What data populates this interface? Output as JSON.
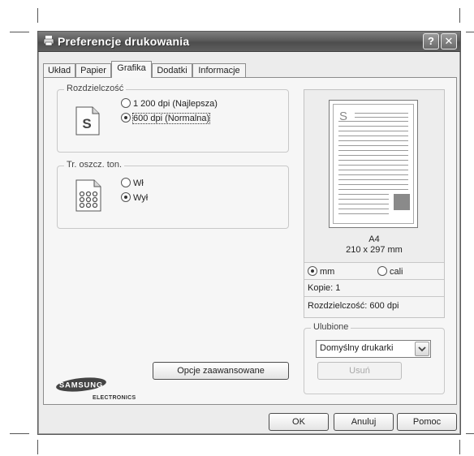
{
  "window": {
    "title": "Preferencje drukowania",
    "help_label": "?",
    "close_label": "✕"
  },
  "tabs": [
    {
      "label": "Układ",
      "active": false
    },
    {
      "label": "Papier",
      "active": false
    },
    {
      "label": "Grafika",
      "active": true
    },
    {
      "label": "Dodatki",
      "active": false
    },
    {
      "label": "Informacje",
      "active": false
    }
  ],
  "resolution": {
    "legend": "Rozdzielczość",
    "icon_letter": "S",
    "options": [
      {
        "label": "1 200 dpi (Najlepsza)",
        "selected": false
      },
      {
        "label": "600 dpi (Normalna)",
        "selected": true
      }
    ]
  },
  "toner_save": {
    "legend": "Tr. oszcz. ton.",
    "options": [
      {
        "label": "Wł",
        "selected": false
      },
      {
        "label": "Wył",
        "selected": true
      }
    ]
  },
  "advanced_button": "Opcje zaawansowane",
  "logo": {
    "brand": "SAMSUNG",
    "sub": "ELECTRONICS"
  },
  "preview": {
    "paper_letter": "S",
    "paper_name": "A4",
    "paper_size": "210 x 297 mm",
    "units": [
      {
        "label": "mm",
        "selected": true
      },
      {
        "label": "cali",
        "selected": false
      }
    ],
    "copies": "Kopie: 1",
    "resolution": "Rozdzielczość: 600 dpi"
  },
  "favorites": {
    "legend": "Ulubione",
    "selected": "Domyślny drukarki",
    "delete_button": "Usuń"
  },
  "footer": {
    "ok": "OK",
    "cancel": "Anuluj",
    "help": "Pomoc"
  },
  "colors": {
    "titlebar": "#5b5b5b",
    "dialog_bg": "#ececec"
  }
}
